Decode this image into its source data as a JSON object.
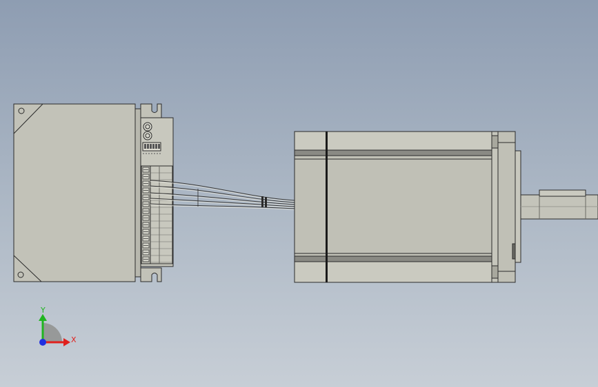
{
  "viewport": {
    "background_top": "#8e9db2",
    "background_bottom": "#c7ced6",
    "part_fill": "#c0c0b6",
    "part_outline": "#2a2a2a"
  },
  "triad": {
    "x_label": "X",
    "y_label": "Y",
    "x_color": "#e0201c",
    "y_color": "#1fb51f",
    "z_color": "#1f2fe0"
  }
}
